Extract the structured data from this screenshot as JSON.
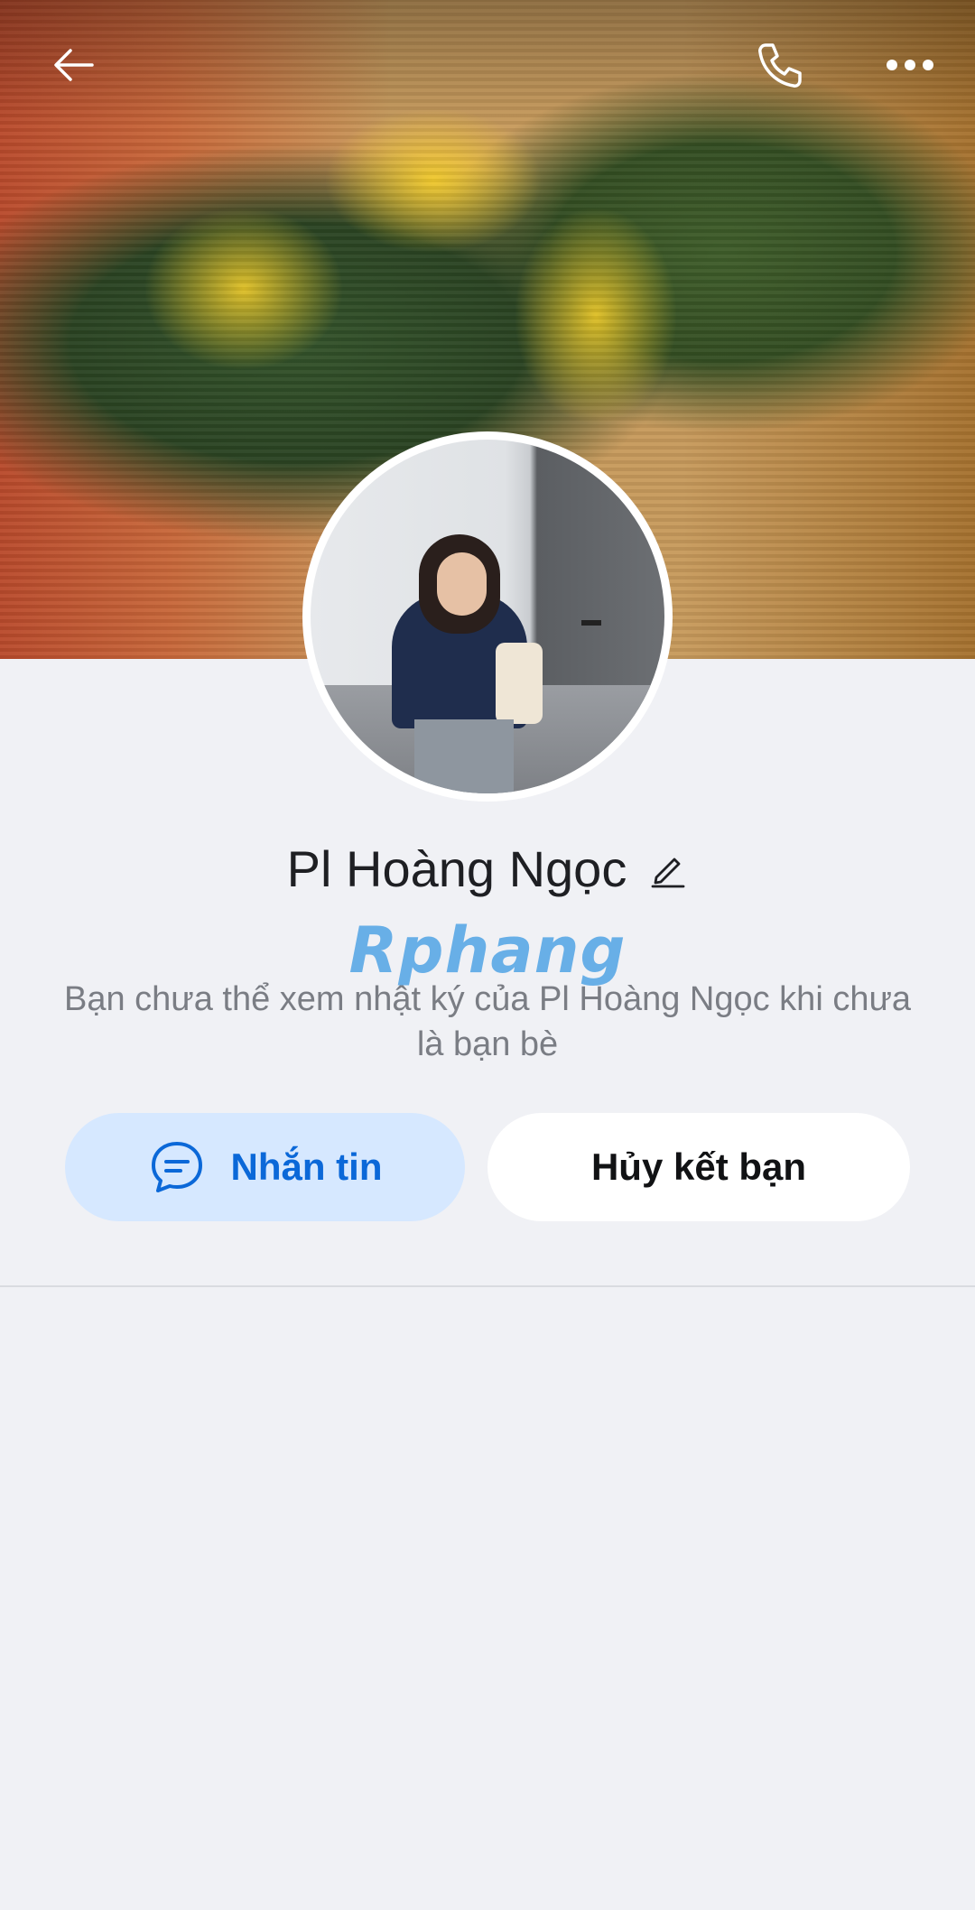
{
  "header": {
    "back_icon": "arrow-left-icon",
    "call_icon": "phone-icon",
    "more_icon": "more-horizontal-icon"
  },
  "profile": {
    "name": "Pl Hoàng Ngọc",
    "edit_icon": "pencil-icon",
    "watermark": "Rphang",
    "notice": "Bạn chưa thể xem nhật ký của Pl Hoàng Ngọc khi chưa là bạn bè"
  },
  "actions": {
    "message_label": "Nhắn tin",
    "message_icon": "chat-bubble-icon",
    "unfriend_label": "Hủy kết bạn"
  },
  "colors": {
    "background": "#f0f1f5",
    "accent": "#0b68d8",
    "message_button_bg": "#d6e8ff"
  }
}
